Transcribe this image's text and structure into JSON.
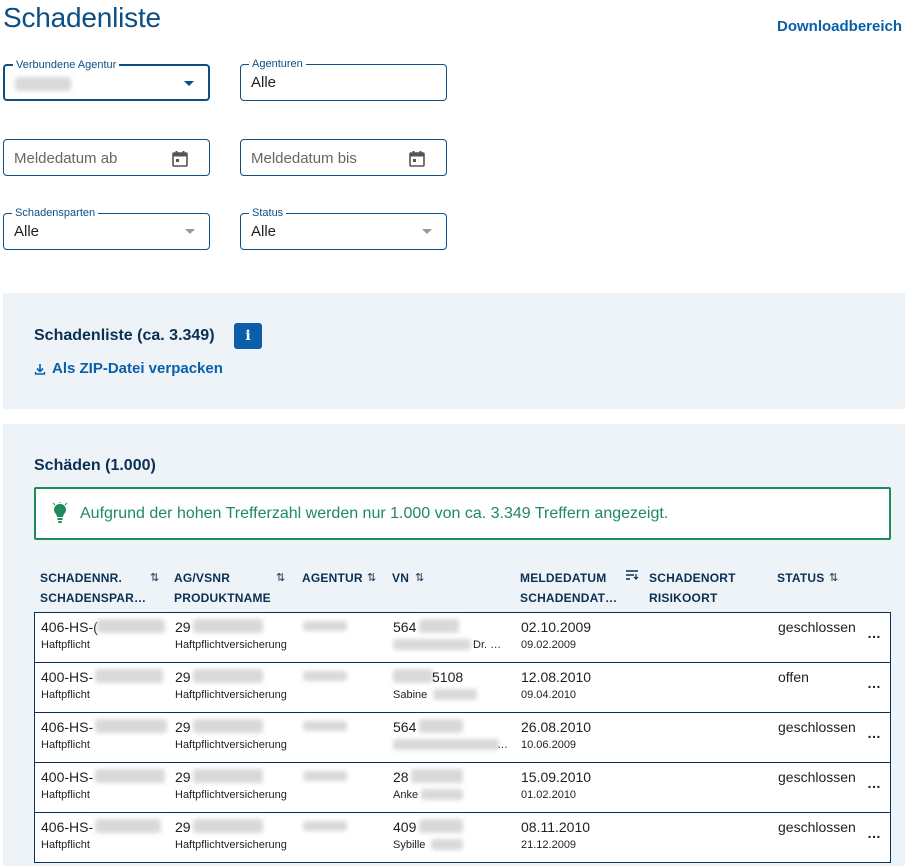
{
  "header": {
    "title": "Schadenliste",
    "download_link": "Downloadbereich"
  },
  "filters": {
    "verbundene_agentur": {
      "label": "Verbundene Agentur",
      "value": ""
    },
    "agenturen": {
      "label": "Agenturen",
      "value": "Alle"
    },
    "meldedatum_ab": {
      "placeholder": "Meldedatum ab"
    },
    "meldedatum_bis": {
      "placeholder": "Meldedatum bis"
    },
    "schadensparten": {
      "label": "Schadensparten",
      "value": "Alle"
    },
    "status": {
      "label": "Status",
      "value": "Alle"
    }
  },
  "summary_panel": {
    "title": "Schadenliste (ca. 3.349)",
    "info_icon": "i",
    "zip_link": "Als ZIP-Datei verpacken"
  },
  "results_panel": {
    "title": "Schäden (1.000)",
    "alert": "Aufgrund der hohen Trefferzahl werden nur 1.000 von ca. 3.349 Treffern angezeigt."
  },
  "table": {
    "headers": {
      "schadennr": "SCHADENNR.",
      "schadensparte": "SCHADENSPAR…",
      "agvsnr": "AG/VSNR",
      "produktname": "PRODUKTNAME",
      "agentur": "AGENTUR",
      "vn": "VN",
      "meldedatum": "MELDEDATUM",
      "schadendatum": "SCHADENDAT…",
      "schadenort": "SCHADENORT",
      "risikoort": "RISIKOORT",
      "status": "STATUS"
    },
    "rows": [
      {
        "schadennr": "406-HS-(",
        "sparte": "Haftpflicht",
        "agvsnr": "29",
        "produkt": "Haftpflichtversicherung",
        "vn": "564",
        "vn_sub": "Dr. …",
        "meldedatum": "02.10.2009",
        "schadendatum": "09.02.2009",
        "status": "geschlossen"
      },
      {
        "schadennr": "400-HS-",
        "sparte": "Haftpflicht",
        "agvsnr": "29",
        "produkt": "Haftpflichtversicherung",
        "vn": "5108",
        "vn_sub": "Sabine",
        "meldedatum": "12.08.2010",
        "schadendatum": "09.04.2010",
        "status": "offen"
      },
      {
        "schadennr": "406-HS-",
        "sparte": "Haftpflicht",
        "agvsnr": "29",
        "produkt": "Haftpflichtversicherung",
        "vn": "564",
        "vn_sub": "…",
        "meldedatum": "26.08.2010",
        "schadendatum": "10.06.2009",
        "status": "geschlossen"
      },
      {
        "schadennr": "400-HS-",
        "sparte": "Haftpflicht",
        "agvsnr": "29",
        "produkt": "Haftpflichtversicherung",
        "vn": "28",
        "vn_sub": "Anke",
        "meldedatum": "15.09.2010",
        "schadendatum": "01.02.2010",
        "status": "geschlossen"
      },
      {
        "schadennr": "406-HS-",
        "sparte": "Haftpflicht",
        "agvsnr": "29",
        "produkt": "Haftpflichtversicherung",
        "vn": "409",
        "vn_sub": "Sybille",
        "meldedatum": "08.11.2010",
        "schadendatum": "21.12.2009",
        "status": "geschlossen"
      }
    ],
    "row_action_icon": "…"
  },
  "colors": {
    "primary": "#0b4f86",
    "link": "#0b5ea8",
    "success": "#1f8a5c",
    "panel_bg": "#eef3f7"
  }
}
